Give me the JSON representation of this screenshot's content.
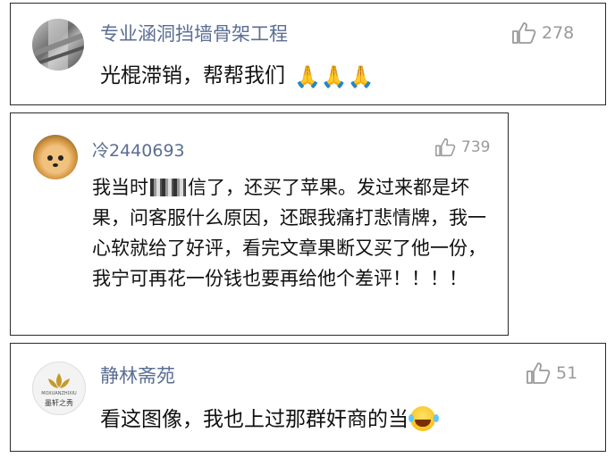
{
  "comments": [
    {
      "username": "专业涵洞挡墙骨架工程",
      "likes": "278",
      "text": "光棍滞销，帮帮我们",
      "emoji": "🙏🙏🙏",
      "avatar_icon": "culvert-photo-avatar"
    },
    {
      "username": "冷2440693",
      "likes": "739",
      "text_start": "我当时",
      "text_rest": "信了，还买了苹果。发过来都是坏果，问客服什么原因，还跟我痛打悲情牌，我一心软就给了好评，看完文章果断又买了他一份，我宁可再花一份钱也要再给他个差评！！！！",
      "avatar_icon": "pomeranian-dog-avatar"
    },
    {
      "username": "静林斋苑",
      "likes": "51",
      "text": "看这图像，我也上过那群奸商的当",
      "avatar_icon": "lotus-logo-avatar",
      "avatar_logo_text": "MOXUANZHIXIU",
      "avatar_logo_cn": "墨轩之秀"
    }
  ],
  "colors": {
    "username": "#5b6e93",
    "likes": "#9a9a9a",
    "border": "#2a2a2a"
  }
}
